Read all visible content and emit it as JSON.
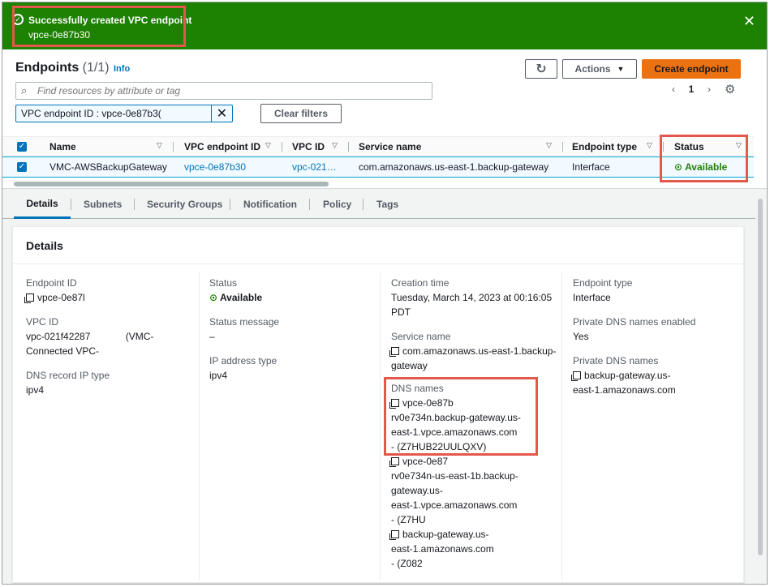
{
  "flash": {
    "title": "Successfully created VPC endpoint",
    "endpoint_id": "vpce-0e87b30",
    "icon": "check-circle-icon",
    "color": "#1d8102"
  },
  "header": {
    "title": "Endpoints",
    "count": "(1/1)",
    "info": "Info",
    "actions_label": "Actions",
    "create_label": "Create endpoint",
    "accent": "#ec7211"
  },
  "search": {
    "placeholder": "Find resources by attribute or tag"
  },
  "filter": {
    "token": "VPC endpoint ID : vpce-0e87b3(",
    "clear_label": "Clear filters"
  },
  "pagination": {
    "current": "1"
  },
  "table": {
    "headers": [
      "Name",
      "VPC endpoint ID",
      "VPC ID",
      "Service name",
      "Endpoint type",
      "Status"
    ],
    "row": {
      "name": "VMC-AWSBackupGateway",
      "endpoint_id": "vpce-0e87b30",
      "vpc_id": "vpc-021…",
      "service": "com.amazonaws.us-east-1.backup-gateway",
      "type": "Interface",
      "status": "Available"
    }
  },
  "tabs": [
    "Details",
    "Subnets",
    "Security Groups",
    "Notification",
    "Policy",
    "Tags"
  ],
  "details": {
    "title": "Details",
    "endpoint_id_label": "Endpoint ID",
    "endpoint_id": "vpce-0e87l",
    "vpc_id_label": "VPC ID",
    "vpc_id_1": "vpc-021f42287",
    "vpc_id_2": "(VMC-",
    "vpc_id_3": "Connected VPC-",
    "dns_ip_label": "DNS record IP type",
    "dns_ip": "ipv4",
    "status_label": "Status",
    "status": "Available",
    "status_msg_label": "Status message",
    "status_msg": "–",
    "ip_type_label": "IP address type",
    "ip_type": "ipv4",
    "creation_label": "Creation time",
    "creation_1": "Tuesday, March 14, 2023 at 00:16:05",
    "creation_2": "PDT",
    "service_label": "Service name",
    "service_1": "com.amazonaws.us-east-1.backup-",
    "service_2": "gateway",
    "dns_names_label": "DNS names",
    "dns": [
      [
        "vpce-0e87b",
        "rv0e734n.backup-gateway.us-",
        "east-1.vpce.amazonaws.com",
        "- (Z7HUB22UULQXV)"
      ],
      [
        "vpce-0e87",
        "rv0e734n-us-east-1b.backup-",
        "gateway.us-",
        "east-1.vpce.amazonaws.com",
        "- (Z7HU"
      ],
      [
        "backup-gateway.us-",
        "east-1.amazonaws.com",
        "- (Z082"
      ]
    ],
    "endpoint_type_label": "Endpoint type",
    "endpoint_type": "Interface",
    "private_dns_label": "Private DNS names enabled",
    "private_dns": "Yes",
    "private_names_label": "Private DNS names",
    "private_names_1": "backup-gateway.us-",
    "private_names_2": "east-1.amazonaws.com"
  }
}
